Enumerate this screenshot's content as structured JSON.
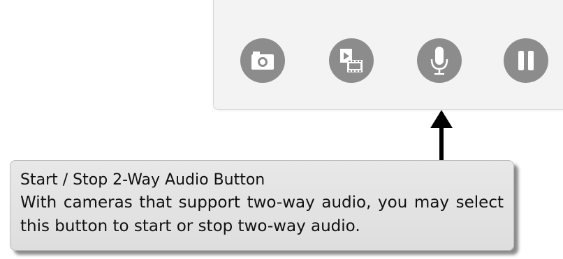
{
  "toolbar": {
    "buttons": [
      {
        "name": "snapshot-button",
        "icon": "camera-icon"
      },
      {
        "name": "record-button",
        "icon": "video-record-icon"
      },
      {
        "name": "two-way-audio-button",
        "icon": "microphone-icon"
      },
      {
        "name": "pause-button",
        "icon": "pause-icon"
      }
    ],
    "button_color": "#8c8c8c",
    "background_color": "#f3f3f3"
  },
  "callout": {
    "title": "Start / Stop 2-Way Audio Button",
    "description": "With cameras that support two-way audio, you may select this button to start or stop two-way audio."
  }
}
